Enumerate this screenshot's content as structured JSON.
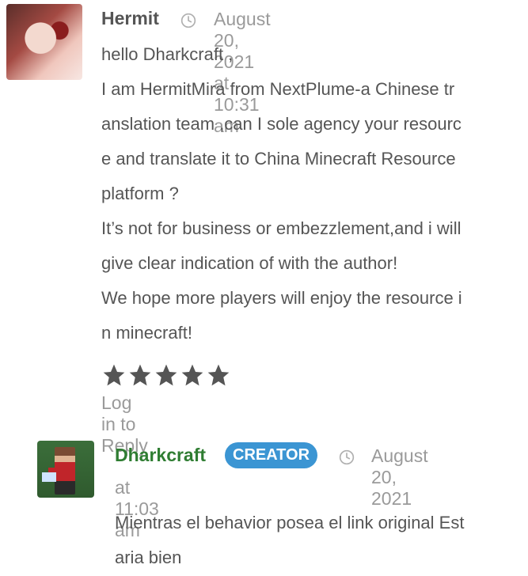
{
  "comments": [
    {
      "author": "Hermit",
      "date": "August 20, 2021 at 10:31 am",
      "body_lines": [
        "hello Dharkcraft ,",
        "I am HermitMira from NextPlume-a Chinese tr",
        "anslation team ,can I sole agency your resourc",
        "e and translate it to China Minecraft Resource",
        "platform ?",
        "It’s not for business or embezzlement,and i will",
        "give clear indication of with the author!",
        "We hope more players will enjoy the resource i",
        "n minecraft!"
      ],
      "rating": 5,
      "reply_label": "Log in to Reply"
    },
    {
      "author": "Dharkcraft",
      "badge": "CREATOR",
      "date_part1": "August 20, 2021",
      "date_part2": "at 11:03 am",
      "body_lines": [
        "Mientras el behavior posea el link original Est",
        "aria bien"
      ]
    }
  ],
  "icons": {
    "clock": "clock-icon",
    "star": "star-icon"
  },
  "colors": {
    "creator_name": "#2f7d32",
    "badge_bg": "#3b95d3",
    "meta": "#9a9a9a",
    "text": "#555555",
    "stars": "#555555"
  }
}
